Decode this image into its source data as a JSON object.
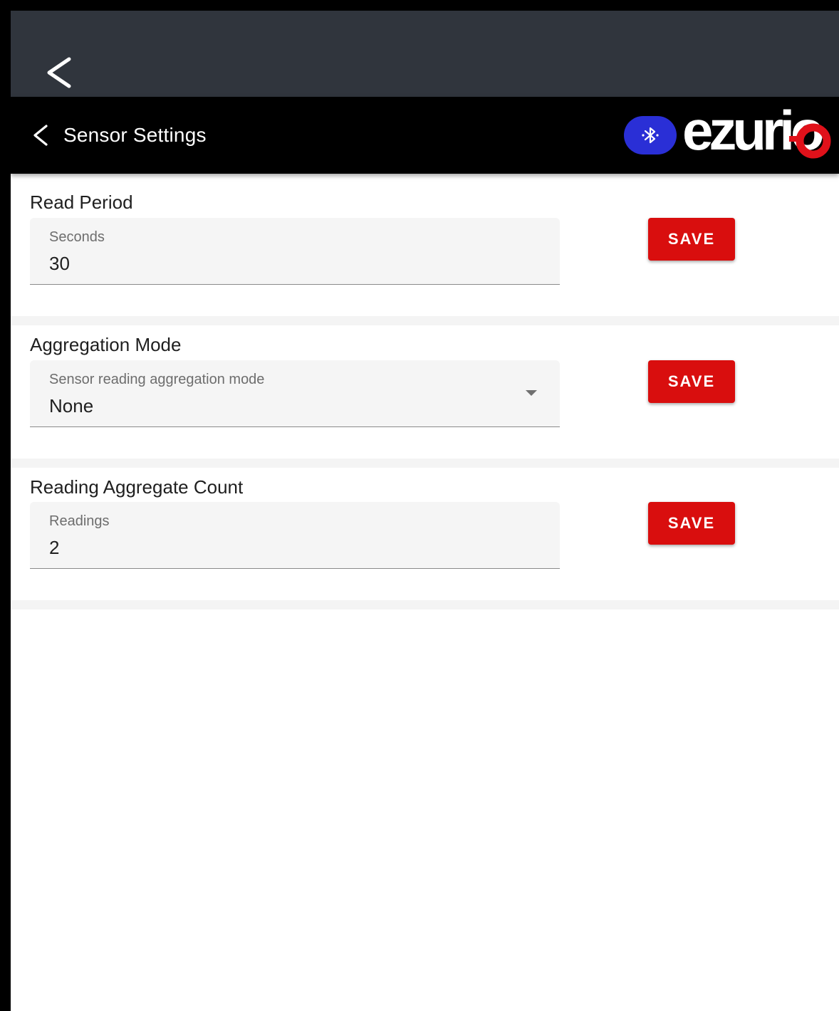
{
  "outer_bar": {
    "back_icon": "chevron-left-icon"
  },
  "app_bar": {
    "back_icon": "chevron-left-icon",
    "title": "Sensor Settings",
    "bluetooth_icon": "bluetooth-icon",
    "logo_text": "ezurio"
  },
  "colors": {
    "outer_bar": "#30353d",
    "app_bar": "#000000",
    "accent_red": "#d90e0e",
    "bluetooth_blue": "#2a2fd6",
    "field_bg": "#f5f5f5",
    "separator": "#f4f4f4"
  },
  "sections": [
    {
      "title": "Read Period",
      "field_label": "Seconds",
      "field_value": "30",
      "field_type": "number",
      "save_label": "SAVE"
    },
    {
      "title": "Aggregation Mode",
      "field_label": "Sensor reading aggregation mode",
      "field_value": "None",
      "field_type": "select",
      "save_label": "SAVE"
    },
    {
      "title": "Reading Aggregate Count",
      "field_label": "Readings",
      "field_value": "2",
      "field_type": "number",
      "save_label": "SAVE"
    }
  ]
}
